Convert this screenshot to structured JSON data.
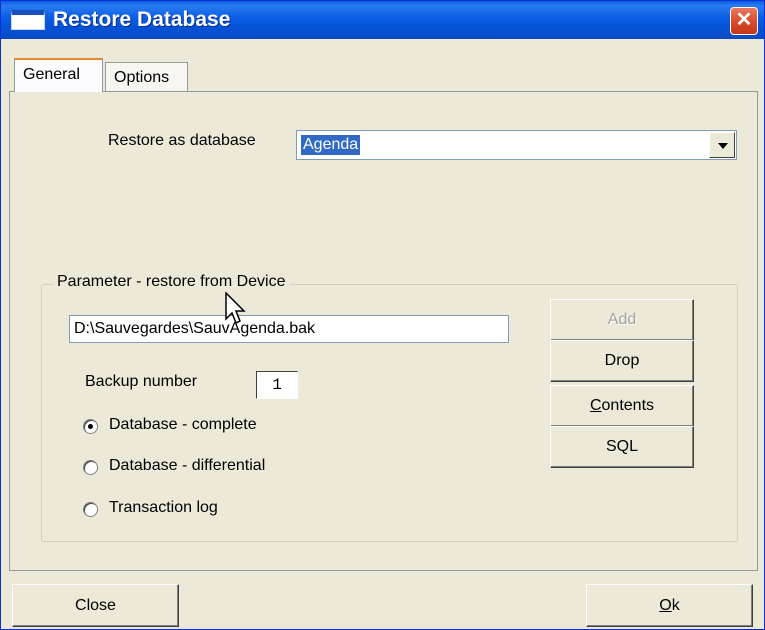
{
  "window": {
    "title": "Restore Database",
    "close_glyph": "✕"
  },
  "tabs": [
    {
      "label": "General",
      "active": true
    },
    {
      "label": "Options",
      "active": false
    }
  ],
  "general": {
    "restore_as_label": "Restore as database",
    "restore_as_value": "Agenda",
    "group_title": "Parameter - restore from Device",
    "device_path": "D:\\Sauvegardes\\SauvAgenda.bak",
    "backup_number_label": "Backup number",
    "backup_number": "1",
    "radios": [
      {
        "label": "Database - complete",
        "checked": true
      },
      {
        "label": "Database - differential",
        "checked": false
      },
      {
        "label": "Transaction log",
        "checked": false
      }
    ],
    "buttons": {
      "add": "Add",
      "drop": "Drop",
      "contents_c": "C",
      "contents_rest": "ontents",
      "sql": "SQL"
    }
  },
  "footer": {
    "close": "Close",
    "ok_o": "O",
    "ok_rest": "k"
  },
  "icons": {
    "title_icon": "window-icon",
    "close_icon": "close-icon",
    "combo_arrow": "chevron-down-icon",
    "mouse_cursor": "arrow-cursor-icon"
  },
  "colors": {
    "titlebar": "#0a5ce4",
    "face": "#ece9d8",
    "selection": "#316ac5",
    "close_button": "#d9482b"
  }
}
